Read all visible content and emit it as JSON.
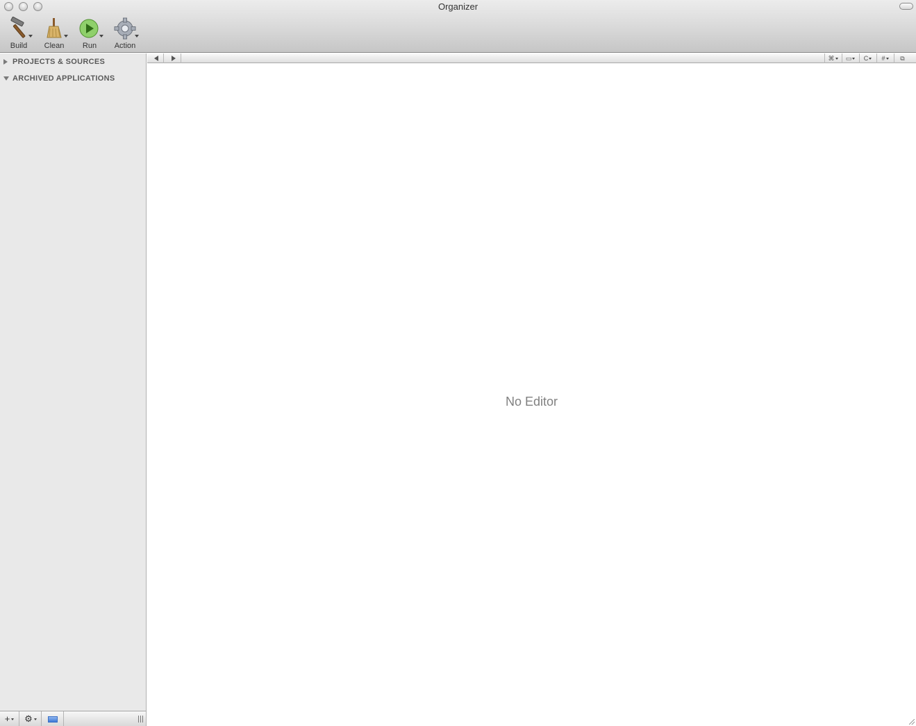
{
  "window": {
    "title": "Organizer"
  },
  "toolbar": {
    "build_label": "Build",
    "clean_label": "Clean",
    "run_label": "Run",
    "action_label": "Action"
  },
  "sidebar": {
    "groups": [
      {
        "label": "PROJECTS & SOURCES",
        "expanded": false
      },
      {
        "label": "ARCHIVED APPLICATIONS",
        "expanded": true
      }
    ],
    "bottom": {
      "add_label": "+",
      "gear_label": "⚙"
    }
  },
  "editor_nav": {
    "tools": [
      "⌘",
      "▭",
      "C",
      "#",
      "⧉"
    ]
  },
  "editor": {
    "empty_message": "No Editor"
  },
  "colors": {
    "sidebar_bg": "#e9e9e9",
    "empty_text": "#808080",
    "run_green": "#5fae3e"
  }
}
